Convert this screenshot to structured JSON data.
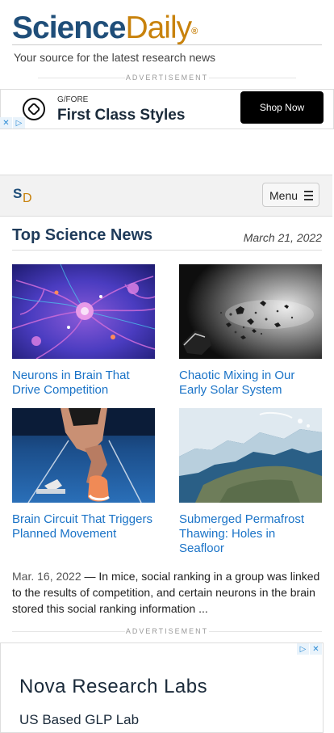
{
  "header": {
    "logo_science": "Science",
    "logo_daily": "Daily",
    "logo_reg": "®",
    "tagline": "Your source for the latest research news"
  },
  "ads": {
    "label": "ADVERTISEMENT",
    "top": {
      "brand": "G/FORE",
      "title": "First Class Styles",
      "cta": "Shop Now"
    },
    "bottom": {
      "title": "Nova Research Labs",
      "subtitle": "US Based GLP Lab"
    }
  },
  "nav": {
    "logo_s": "S",
    "logo_d": "D",
    "menu_label": "Menu"
  },
  "section": {
    "title": "Top Science News",
    "date": "March 21, 2022"
  },
  "stories": [
    {
      "title": "Neurons in Brain That Drive Competition",
      "image": "neurons-illustration"
    },
    {
      "title": "Chaotic Mixing in Our Early Solar System",
      "image": "asteroid-field"
    },
    {
      "title": "Brain Circuit That Triggers Planned Movement",
      "image": "runner-starting-blocks"
    },
    {
      "title": "Submerged Permafrost Thawing: Holes in Seafloor",
      "image": "arctic-satellite-map"
    }
  ],
  "summary": {
    "date": "Mar. 16, 2022",
    "dash": "—",
    "text": "In mice, social ranking in a group was linked to the results of competition, and certain neurons in the brain stored this social ranking information ..."
  },
  "colors": {
    "brand_blue": "#1f4e79",
    "brand_gold": "#c8820c",
    "link": "#1a73c7"
  },
  "icons": [
    "gfore-logo-icon",
    "adchoices-icon",
    "close-icon",
    "hamburger-icon"
  ]
}
